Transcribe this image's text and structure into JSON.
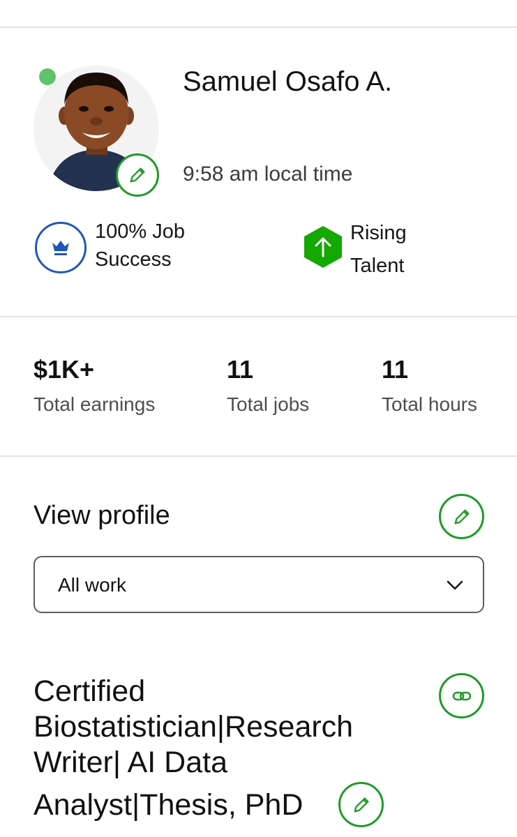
{
  "profile": {
    "name": "Samuel Osafo A.",
    "local_time": "9:58 am local time",
    "status": "online"
  },
  "badges": {
    "job_success": {
      "line1": "100% Job",
      "line2": "Success",
      "icon": "crown-icon"
    },
    "rising_talent": {
      "line1": "Rising",
      "line2": "Talent",
      "icon": "arrow-up-icon"
    }
  },
  "stats": [
    {
      "value": "$1K+",
      "label": "Total earnings"
    },
    {
      "value": "11",
      "label": "Total jobs"
    },
    {
      "value": "11",
      "label": "Total hours"
    }
  ],
  "view_profile": {
    "heading": "View profile",
    "dropdown_value": "All work"
  },
  "title": {
    "lines": [
      "Certified",
      "Biostatistician|Research",
      "Writer| AI Data",
      "Analyst|Thesis, PhD"
    ]
  },
  "colors": {
    "accent_green": "#1f9a27",
    "online_dot": "#5fc36a",
    "job_success_blue": "#1f57b5",
    "rising_talent_green": "#14a800"
  }
}
